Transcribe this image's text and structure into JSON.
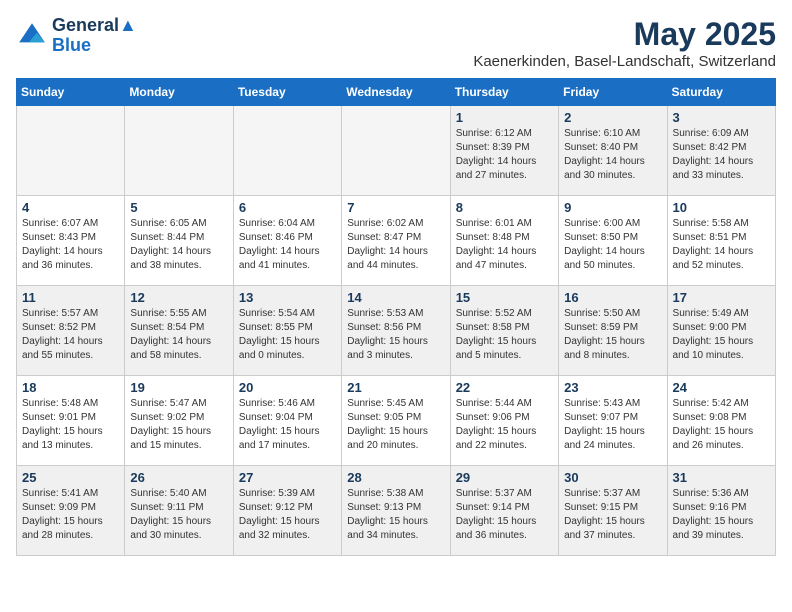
{
  "logo": {
    "line1": "General",
    "line2": "Blue"
  },
  "title": "May 2025",
  "subtitle": "Kaenerkinden, Basel-Landschaft, Switzerland",
  "days_of_week": [
    "Sunday",
    "Monday",
    "Tuesday",
    "Wednesday",
    "Thursday",
    "Friday",
    "Saturday"
  ],
  "weeks": [
    [
      {
        "day": "",
        "info": ""
      },
      {
        "day": "",
        "info": ""
      },
      {
        "day": "",
        "info": ""
      },
      {
        "day": "",
        "info": ""
      },
      {
        "day": "1",
        "info": "Sunrise: 6:12 AM\nSunset: 8:39 PM\nDaylight: 14 hours\nand 27 minutes."
      },
      {
        "day": "2",
        "info": "Sunrise: 6:10 AM\nSunset: 8:40 PM\nDaylight: 14 hours\nand 30 minutes."
      },
      {
        "day": "3",
        "info": "Sunrise: 6:09 AM\nSunset: 8:42 PM\nDaylight: 14 hours\nand 33 minutes."
      }
    ],
    [
      {
        "day": "4",
        "info": "Sunrise: 6:07 AM\nSunset: 8:43 PM\nDaylight: 14 hours\nand 36 minutes."
      },
      {
        "day": "5",
        "info": "Sunrise: 6:05 AM\nSunset: 8:44 PM\nDaylight: 14 hours\nand 38 minutes."
      },
      {
        "day": "6",
        "info": "Sunrise: 6:04 AM\nSunset: 8:46 PM\nDaylight: 14 hours\nand 41 minutes."
      },
      {
        "day": "7",
        "info": "Sunrise: 6:02 AM\nSunset: 8:47 PM\nDaylight: 14 hours\nand 44 minutes."
      },
      {
        "day": "8",
        "info": "Sunrise: 6:01 AM\nSunset: 8:48 PM\nDaylight: 14 hours\nand 47 minutes."
      },
      {
        "day": "9",
        "info": "Sunrise: 6:00 AM\nSunset: 8:50 PM\nDaylight: 14 hours\nand 50 minutes."
      },
      {
        "day": "10",
        "info": "Sunrise: 5:58 AM\nSunset: 8:51 PM\nDaylight: 14 hours\nand 52 minutes."
      }
    ],
    [
      {
        "day": "11",
        "info": "Sunrise: 5:57 AM\nSunset: 8:52 PM\nDaylight: 14 hours\nand 55 minutes."
      },
      {
        "day": "12",
        "info": "Sunrise: 5:55 AM\nSunset: 8:54 PM\nDaylight: 14 hours\nand 58 minutes."
      },
      {
        "day": "13",
        "info": "Sunrise: 5:54 AM\nSunset: 8:55 PM\nDaylight: 15 hours\nand 0 minutes."
      },
      {
        "day": "14",
        "info": "Sunrise: 5:53 AM\nSunset: 8:56 PM\nDaylight: 15 hours\nand 3 minutes."
      },
      {
        "day": "15",
        "info": "Sunrise: 5:52 AM\nSunset: 8:58 PM\nDaylight: 15 hours\nand 5 minutes."
      },
      {
        "day": "16",
        "info": "Sunrise: 5:50 AM\nSunset: 8:59 PM\nDaylight: 15 hours\nand 8 minutes."
      },
      {
        "day": "17",
        "info": "Sunrise: 5:49 AM\nSunset: 9:00 PM\nDaylight: 15 hours\nand 10 minutes."
      }
    ],
    [
      {
        "day": "18",
        "info": "Sunrise: 5:48 AM\nSunset: 9:01 PM\nDaylight: 15 hours\nand 13 minutes."
      },
      {
        "day": "19",
        "info": "Sunrise: 5:47 AM\nSunset: 9:02 PM\nDaylight: 15 hours\nand 15 minutes."
      },
      {
        "day": "20",
        "info": "Sunrise: 5:46 AM\nSunset: 9:04 PM\nDaylight: 15 hours\nand 17 minutes."
      },
      {
        "day": "21",
        "info": "Sunrise: 5:45 AM\nSunset: 9:05 PM\nDaylight: 15 hours\nand 20 minutes."
      },
      {
        "day": "22",
        "info": "Sunrise: 5:44 AM\nSunset: 9:06 PM\nDaylight: 15 hours\nand 22 minutes."
      },
      {
        "day": "23",
        "info": "Sunrise: 5:43 AM\nSunset: 9:07 PM\nDaylight: 15 hours\nand 24 minutes."
      },
      {
        "day": "24",
        "info": "Sunrise: 5:42 AM\nSunset: 9:08 PM\nDaylight: 15 hours\nand 26 minutes."
      }
    ],
    [
      {
        "day": "25",
        "info": "Sunrise: 5:41 AM\nSunset: 9:09 PM\nDaylight: 15 hours\nand 28 minutes."
      },
      {
        "day": "26",
        "info": "Sunrise: 5:40 AM\nSunset: 9:11 PM\nDaylight: 15 hours\nand 30 minutes."
      },
      {
        "day": "27",
        "info": "Sunrise: 5:39 AM\nSunset: 9:12 PM\nDaylight: 15 hours\nand 32 minutes."
      },
      {
        "day": "28",
        "info": "Sunrise: 5:38 AM\nSunset: 9:13 PM\nDaylight: 15 hours\nand 34 minutes."
      },
      {
        "day": "29",
        "info": "Sunrise: 5:37 AM\nSunset: 9:14 PM\nDaylight: 15 hours\nand 36 minutes."
      },
      {
        "day": "30",
        "info": "Sunrise: 5:37 AM\nSunset: 9:15 PM\nDaylight: 15 hours\nand 37 minutes."
      },
      {
        "day": "31",
        "info": "Sunrise: 5:36 AM\nSunset: 9:16 PM\nDaylight: 15 hours\nand 39 minutes."
      }
    ]
  ]
}
